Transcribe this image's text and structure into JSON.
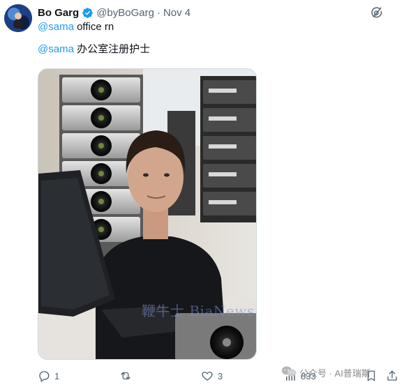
{
  "author": {
    "name": "Bo Garg",
    "handle": "@byBoGarg",
    "separator": "·",
    "date": "Nov 4"
  },
  "tweet": {
    "line1_mention": "@sama",
    "line1_text": " office rn",
    "line2_mention": "@sama",
    "line2_text": " 办公室注册护士"
  },
  "media": {
    "watermark": "鞭牛士 BiaNews"
  },
  "actions": {
    "reply_count": "1",
    "retweet_count": "",
    "like_count": "3",
    "views_count": "833"
  },
  "overlay": {
    "wechat_label": "公众号 · AI普瑞斯"
  },
  "colors": {
    "accent": "#1d9bf0",
    "text": "#0f1419",
    "secondary": "#536471"
  }
}
